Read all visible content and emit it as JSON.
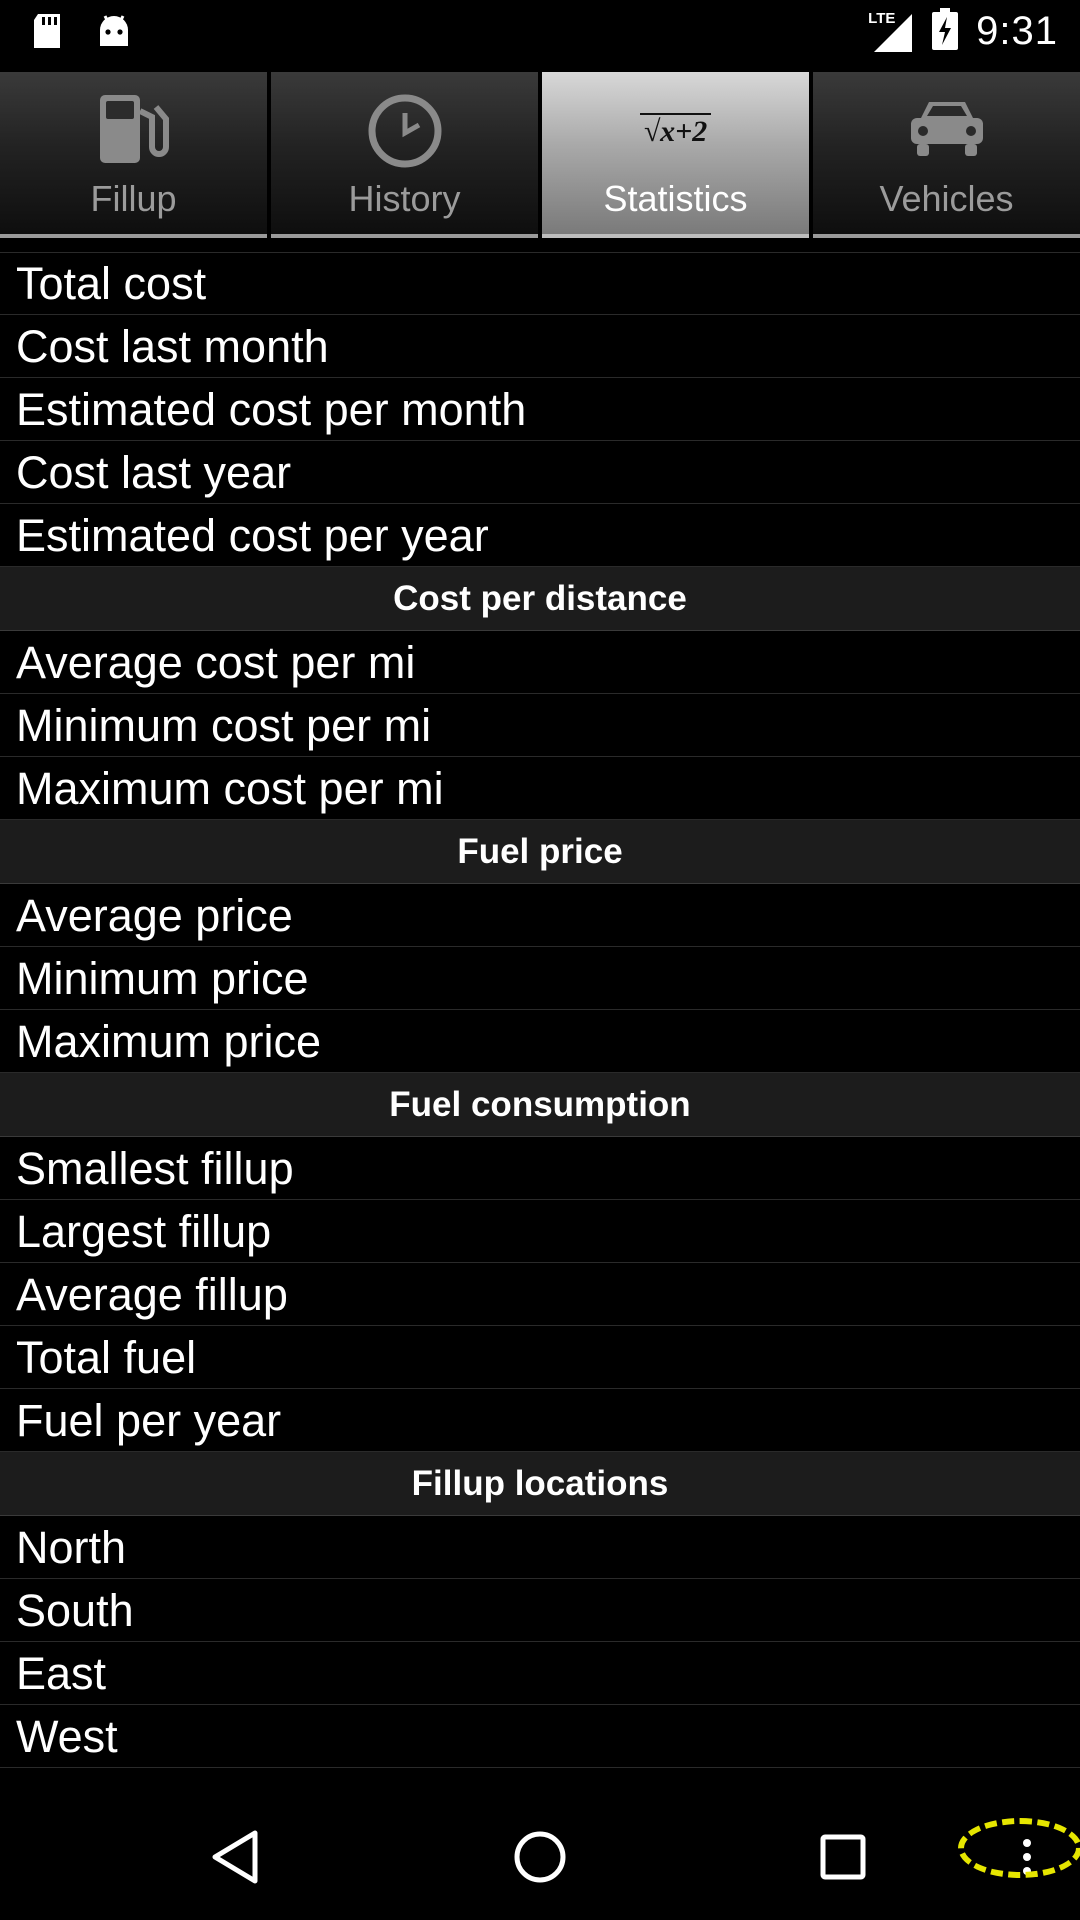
{
  "status_bar": {
    "time": "9:31",
    "network": "LTE",
    "left_icons": [
      "sd-card-icon",
      "android-icon"
    ],
    "right_icons": [
      "lte-signal-icon",
      "battery-charging-icon"
    ]
  },
  "tabs": [
    {
      "label": "Fillup",
      "icon": "fuel-pump-icon",
      "selected": false
    },
    {
      "label": "History",
      "icon": "clock-icon",
      "selected": false
    },
    {
      "label": "Statistics",
      "icon": "sqrt-formula-icon",
      "icon_text": "√x+2",
      "selected": true
    },
    {
      "label": "Vehicles",
      "icon": "car-icon",
      "selected": false
    }
  ],
  "statistics": {
    "cost_rows": [
      "Total cost",
      "Cost last month",
      "Estimated cost per month",
      "Cost last year",
      "Estimated cost per year"
    ],
    "cost_per_distance": {
      "header": "Cost per distance",
      "rows": [
        "Average cost per mi",
        "Minimum cost per mi",
        "Maximum cost per mi"
      ]
    },
    "fuel_price": {
      "header": "Fuel price",
      "rows": [
        "Average price",
        "Minimum price",
        "Maximum price"
      ]
    },
    "fuel_consumption": {
      "header": "Fuel consumption",
      "rows": [
        "Smallest fillup",
        "Largest fillup",
        "Average fillup",
        "Total fuel",
        "Fuel per year"
      ]
    },
    "fillup_locations": {
      "header": "Fillup locations",
      "rows": [
        "North",
        "South",
        "East",
        "West"
      ]
    }
  },
  "nav": {
    "icons": [
      "back-icon",
      "home-icon",
      "recents-icon",
      "overflow-menu-icon"
    ],
    "highlight_color": "#e6e600"
  }
}
